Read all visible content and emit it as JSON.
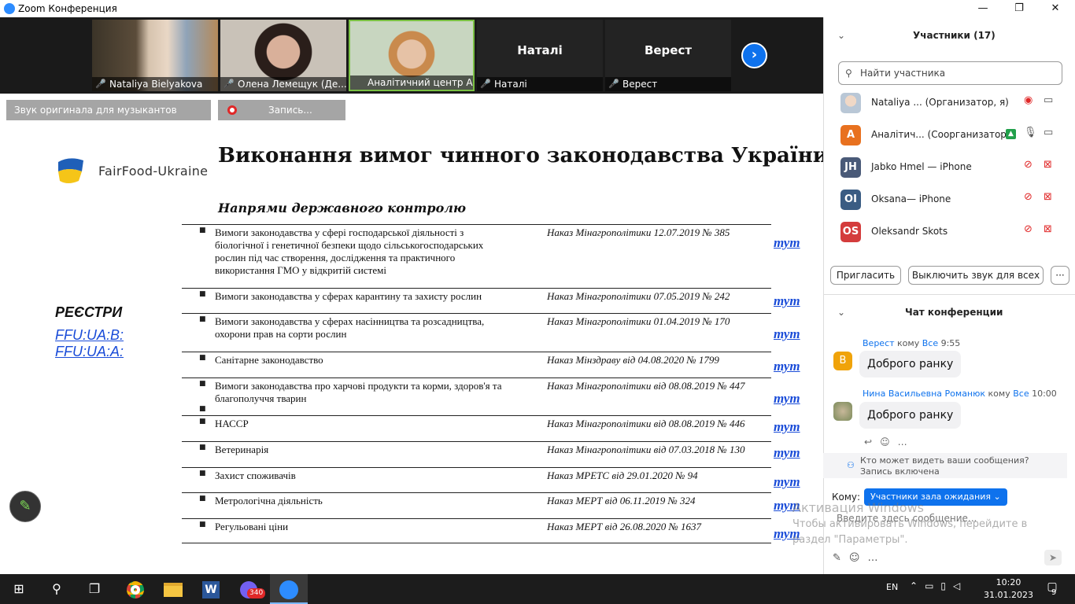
{
  "window": {
    "title": "Zoom Конференция",
    "minimize": "—",
    "maximize": "❐",
    "close": "✕"
  },
  "videos": [
    {
      "name": "Nataliya Bielyakova"
    },
    {
      "name": "Олена Лемещук (Де..."
    },
    {
      "name": "Аналітичний центр Агра..."
    },
    {
      "name": "Наталі",
      "big": "Наталі"
    },
    {
      "name": "Верест",
      "big": "Верест"
    }
  ],
  "notices": {
    "original_sound": "Звук оригинала для музыкантов выключен",
    "recording": "Запись..."
  },
  "slide": {
    "brand": "FairFood-Ukraine",
    "title": "Виконання вимог чинного законодавства України",
    "subtitle": "Напрями державного контролю",
    "registers_heading": "РЕЄСТРИ",
    "registers_links": [
      "FFU:UA:B:",
      "FFU:UA:A:"
    ],
    "rows": [
      {
        "text": "Вимоги законодавства у сфері господарської діяльності з біологічної і генетичної безпеки щодо сільськогосподарських рослин під час створення, дослідження та практичного використання ГМО у відкритій системі",
        "law": "Наказ Мінагрополітики 12.07.2019  № 385",
        "link": "тут"
      },
      {
        "text": "Вимоги законодавства у сферах карантину та захисту рослин",
        "law": "Наказ Мінагрополітики 07.05.2019 № 242",
        "link": "тут"
      },
      {
        "text": "Вимоги законодавства у сферах насінництва та розсадництва, охорони прав на сорти рослин",
        "law": "Наказ Мінагрополітики 01.04.2019  № 170",
        "link": "тут"
      },
      {
        "text": "Санітарне законодавство",
        "law": "Наказ Мінздраву від 04.08.2020  № 1799",
        "link": "тут"
      },
      {
        "text": "Вимоги законодавства про харчові продукти та корми, здоров'я та благополуччя тварин",
        "law": "Наказ Мінагрополітики від 08.08.2019 № 447",
        "link": "тут"
      },
      {
        "text": "НАССР",
        "law": "Наказ Мінагрополітики від 08.08.2019 № 446",
        "link": "тут"
      },
      {
        "text": "Ветеринарія",
        "law": "Наказ Мінагрополітики від 07.03.2018 № 130",
        "link": "тут"
      },
      {
        "text": "Захист споживачів",
        "law": "Наказ МРЕТС від 29.01.2020 № 94",
        "link": "тут"
      },
      {
        "text": "Метрологічна діяльність",
        "law": "Наказ МЕРТ від 06.11.2019 № 324",
        "link": "тут"
      },
      {
        "text": "Регульовані ціни",
        "law": "Наказ МЕРТ від 26.08.2020  № 1637",
        "link": "тут"
      }
    ]
  },
  "participants": {
    "title": "Участники (17)",
    "search_placeholder": "Найти участника",
    "list": [
      {
        "initials": "",
        "name": "Nataliya ...  (Организатор, я)",
        "color": "#c9a98c"
      },
      {
        "initials": "A",
        "name": "Аналітич...  (Соорганизатор)",
        "color": "#e8711f"
      },
      {
        "initials": "JH",
        "name": "Jabko Hmel — iPhone",
        "color": "#4a5a78"
      },
      {
        "initials": "OI",
        "name": "Oksana— iPhone",
        "color": "#3a5c83"
      },
      {
        "initials": "OS",
        "name": "Oleksandr Skots",
        "color": "#d43c3c"
      }
    ],
    "invite": "Пригласить",
    "mute_all": "Выключить звук для всех",
    "more": "···"
  },
  "chat": {
    "title": "Чат конференции",
    "messages": [
      {
        "sender": "Верест",
        "to_label": "кому",
        "to": "Все",
        "time": "9:55",
        "text": "Доброго ранку",
        "avatar": "В",
        "color": "#f0a30a"
      },
      {
        "sender": "Нина Васильевна Романюк",
        "to_label": "кому",
        "to": "Все",
        "time": "10:00",
        "text": "Доброго ранку",
        "avatar": "",
        "color": "#9a9a7a"
      }
    ],
    "who_sees": "Кто может видеть ваши сообщения? Запись включена",
    "to_label": "Кому:",
    "recipient": "Участники зала ожидания",
    "input_placeholder": "Введите здесь сообщение..."
  },
  "watermark": {
    "line1": "Активация Windows",
    "line2": "Чтобы активировать Windows, перейдите в раздел \"Параметры\"."
  },
  "taskbar": {
    "lang": "EN",
    "time": "10:20",
    "date": "31.01.2023",
    "viber_badge": "340",
    "notif_count": "9"
  }
}
